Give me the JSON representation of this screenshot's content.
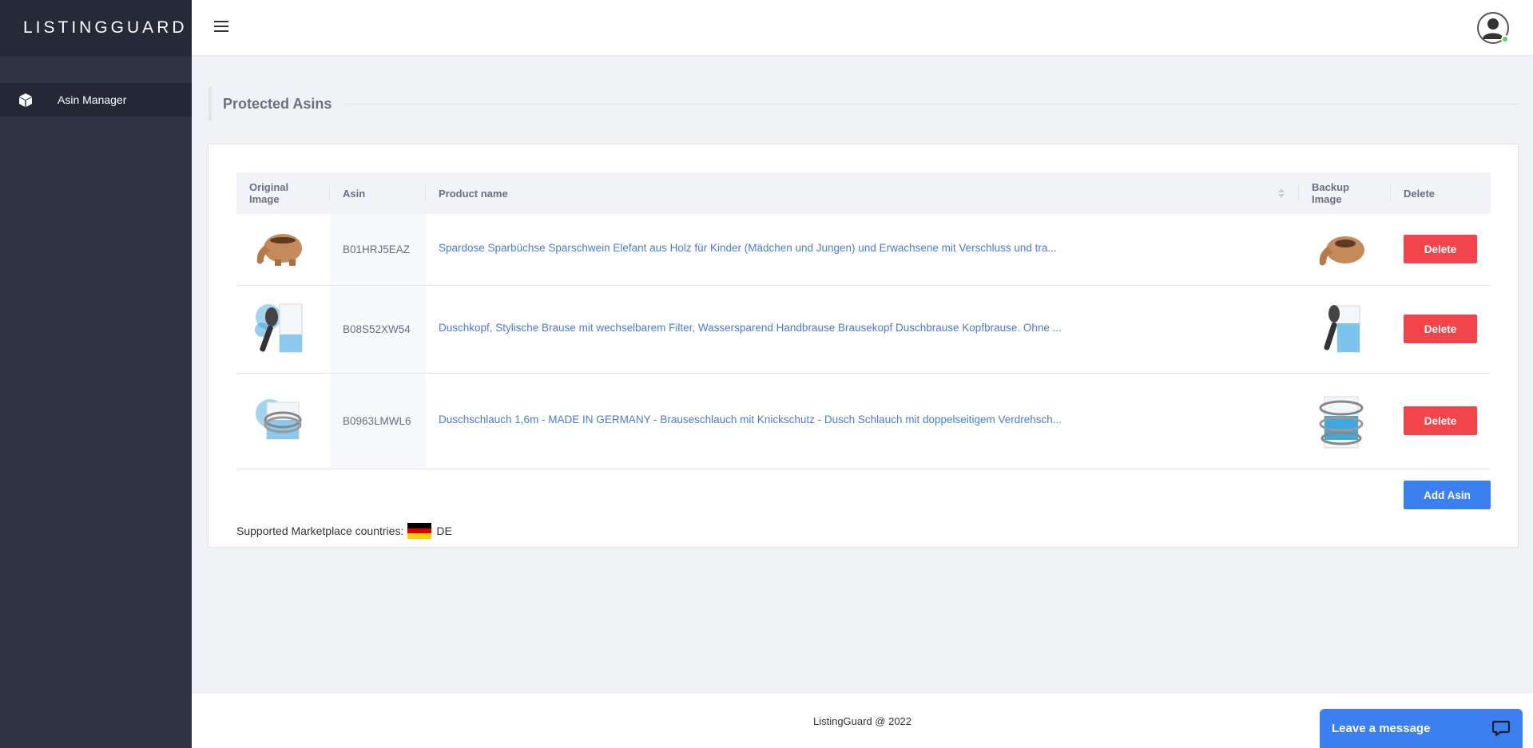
{
  "app": {
    "brand": "LISTINGGUARD"
  },
  "sidebar": {
    "items": [
      {
        "label": "Asin Manager",
        "icon": "box-icon"
      }
    ]
  },
  "page": {
    "title": "Protected Asins"
  },
  "table": {
    "headers": {
      "original_image": "Original Image",
      "asin": "Asin",
      "product_name": "Product name",
      "backup_image": "Backup Image",
      "delete": "Delete"
    },
    "rows": [
      {
        "asin": "B01HRJ5EAZ",
        "product_name": "Spardose Sparbüchse Sparschwein Elefant aus Holz für Kinder (Mädchen und Jungen) und Erwachsene mit Verschluss und tra...",
        "original_image_icon": "wooden-elephant-piggybank-image",
        "backup_image_icon": "wooden-elephant-piggybank-image",
        "delete_label": "Delete"
      },
      {
        "asin": "B08S52XW54",
        "product_name": "Duschkopf, Stylische Brause mit wechselbarem Filter, Wassersparend Handbrause Brausekopf Duschbrause Kopfbrause. Ohne ...",
        "original_image_icon": "shower-head-image",
        "backup_image_icon": "shower-head-image",
        "delete_label": "Delete"
      },
      {
        "asin": "B0963LMWL6",
        "product_name": "Duschschlauch 1,6m - MADE IN GERMANY - Brauseschlauch mit Knickschutz - Dusch Schlauch mit doppelseitigem Verdrehsch...",
        "original_image_icon": "shower-hose-image",
        "backup_image_icon": "shower-hose-image",
        "delete_label": "Delete"
      }
    ]
  },
  "actions": {
    "add_asin": "Add Asin"
  },
  "marketplace": {
    "label": "Supported Marketplace countries:",
    "country": "DE"
  },
  "footer": {
    "copyright": "ListingGuard @ 2022"
  },
  "chat": {
    "label": "Leave a message"
  },
  "colors": {
    "sidebar": "#2e3243",
    "accent_blue": "#3b7ff0",
    "delete_red": "#f2444b",
    "link": "#4a7bd0"
  }
}
